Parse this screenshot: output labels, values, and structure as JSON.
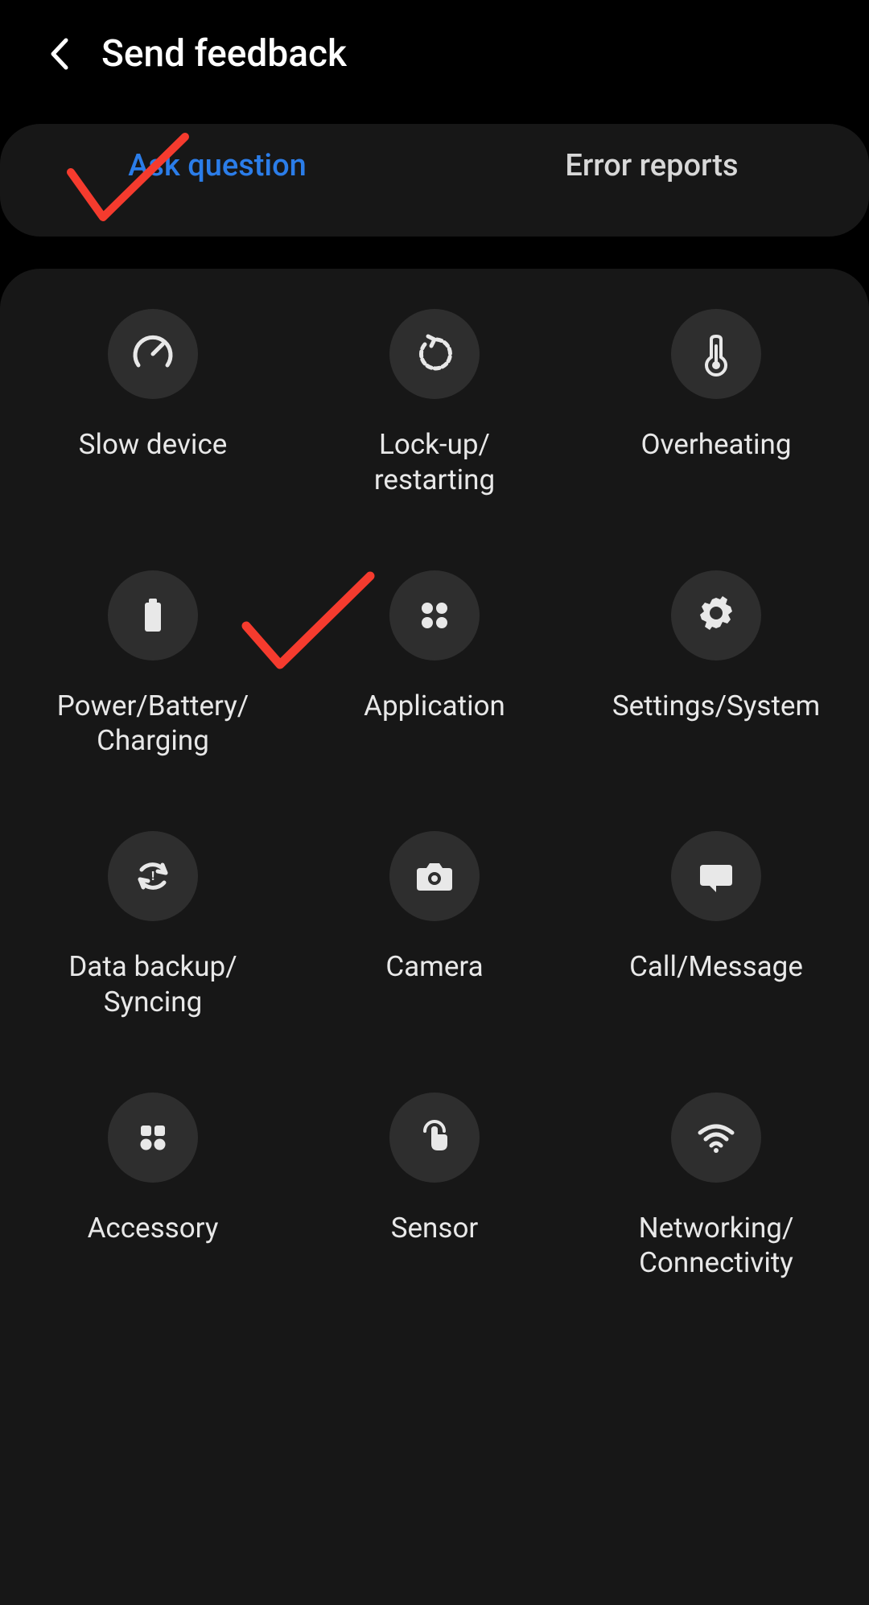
{
  "header": {
    "title": "Send feedback"
  },
  "tabs": {
    "ask_question": "Ask question",
    "error_reports": "Error reports"
  },
  "categories": [
    {
      "label": "Slow device",
      "icon": "speedometer"
    },
    {
      "label": "Lock-up/\nrestarting",
      "icon": "restart"
    },
    {
      "label": "Overheating",
      "icon": "thermometer"
    },
    {
      "label": "Power/Battery/\nCharging",
      "icon": "battery"
    },
    {
      "label": "Application",
      "icon": "apps"
    },
    {
      "label": "Settings/System",
      "icon": "gear"
    },
    {
      "label": "Data backup/\nSyncing",
      "icon": "sync"
    },
    {
      "label": "Camera",
      "icon": "camera"
    },
    {
      "label": "Call/Message",
      "icon": "chat"
    },
    {
      "label": "Accessory",
      "icon": "grid"
    },
    {
      "label": "Sensor",
      "icon": "touch"
    },
    {
      "label": "Networking/\nConnectivity",
      "icon": "wifi"
    }
  ],
  "colors": {
    "accent": "#2b7de9",
    "annotation": "#f53b2e"
  }
}
